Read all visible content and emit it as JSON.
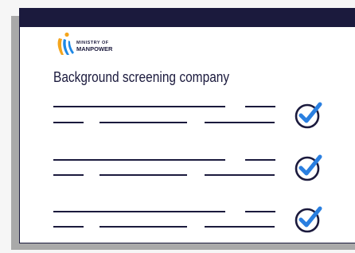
{
  "organization": {
    "name_line1": "MINISTRY OF",
    "name_line2": "MANPOWER",
    "logo_icon": "mom-flame-logo-icon"
  },
  "heading": "Background screening company",
  "rows": [
    {
      "icon": "check-circle-icon"
    },
    {
      "icon": "check-circle-icon"
    },
    {
      "icon": "check-circle-icon"
    }
  ],
  "colors": {
    "navy": "#1b1a3d",
    "check_blue": "#2a7fe0",
    "logo_orange": "#f4a51c",
    "logo_blue": "#1e88e5"
  }
}
